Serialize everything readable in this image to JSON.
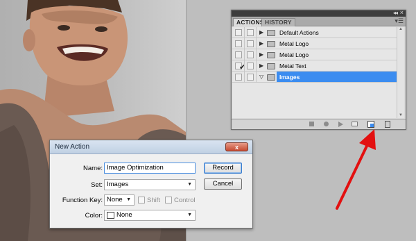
{
  "actions_panel": {
    "tabs": [
      "ACTIONS",
      "HISTORY"
    ],
    "active_tab": "ACTIONS",
    "items": [
      {
        "name": "Default Actions",
        "checked": false,
        "selected": false
      },
      {
        "name": "Metal Logo",
        "checked": false,
        "selected": false
      },
      {
        "name": "Metal Logo",
        "checked": false,
        "selected": false
      },
      {
        "name": "Metal Text",
        "checked": true,
        "selected": false
      },
      {
        "name": "Images",
        "checked": false,
        "selected": true
      }
    ],
    "colors": {
      "selection": "#3b8cf0"
    }
  },
  "dialog": {
    "title": "New Action",
    "name_label": "Name:",
    "name_value": "Image Optimization",
    "set_label": "Set:",
    "set_value": "Images",
    "function_key_label": "Function Key:",
    "function_key_value": "None",
    "shift_label": "Shift",
    "control_label": "Control",
    "color_label": "Color:",
    "color_value": "None",
    "record_label": "Record",
    "cancel_label": "Cancel",
    "close_glyph": "x"
  },
  "annotation": {
    "arrow_color": "#e31010"
  }
}
